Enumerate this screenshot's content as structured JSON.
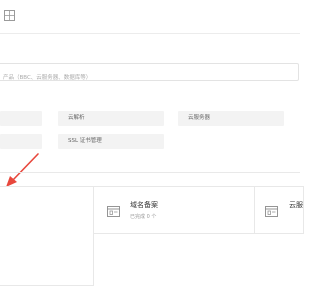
{
  "search": {
    "placeholder": "产品（BBC、云服务器、数据库等）"
  },
  "quick_links": [
    {
      "label": "云解析"
    },
    {
      "label": "云服务器"
    },
    {
      "label": "SSL 证书管理"
    }
  ],
  "cards": [
    {
      "title": "域名备案",
      "status": "已完成 0 个",
      "icon": "browser-window-icon"
    },
    {
      "title": "云服",
      "icon": "browser-window-icon"
    }
  ],
  "colors": {
    "annotation_arrow": "#e8473c",
    "tile_background": "#f3f3f3",
    "border": "#e8e8e8"
  }
}
